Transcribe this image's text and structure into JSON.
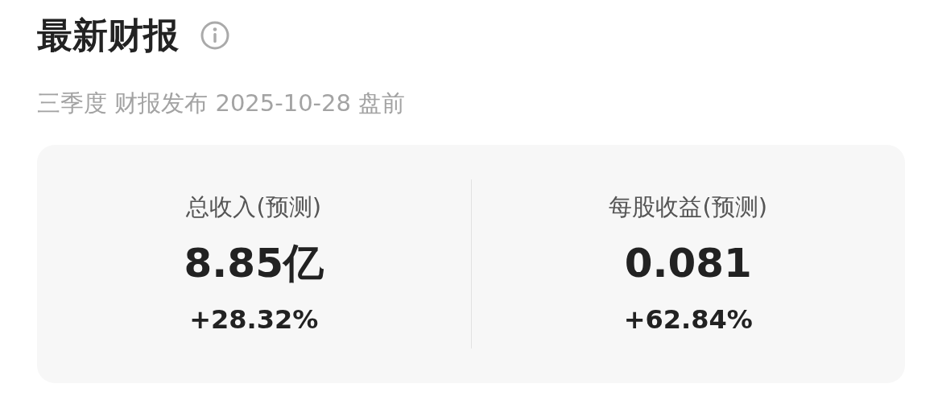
{
  "title": "最新财报",
  "subtitle": "三季度 财报发布 2025-10-28 盘前",
  "metrics": [
    {
      "label": "总收入(预测)",
      "value": "8.85亿",
      "change": "+28.32%"
    },
    {
      "label": "每股收益(预测)",
      "value": "0.081",
      "change": "+62.84%"
    }
  ]
}
